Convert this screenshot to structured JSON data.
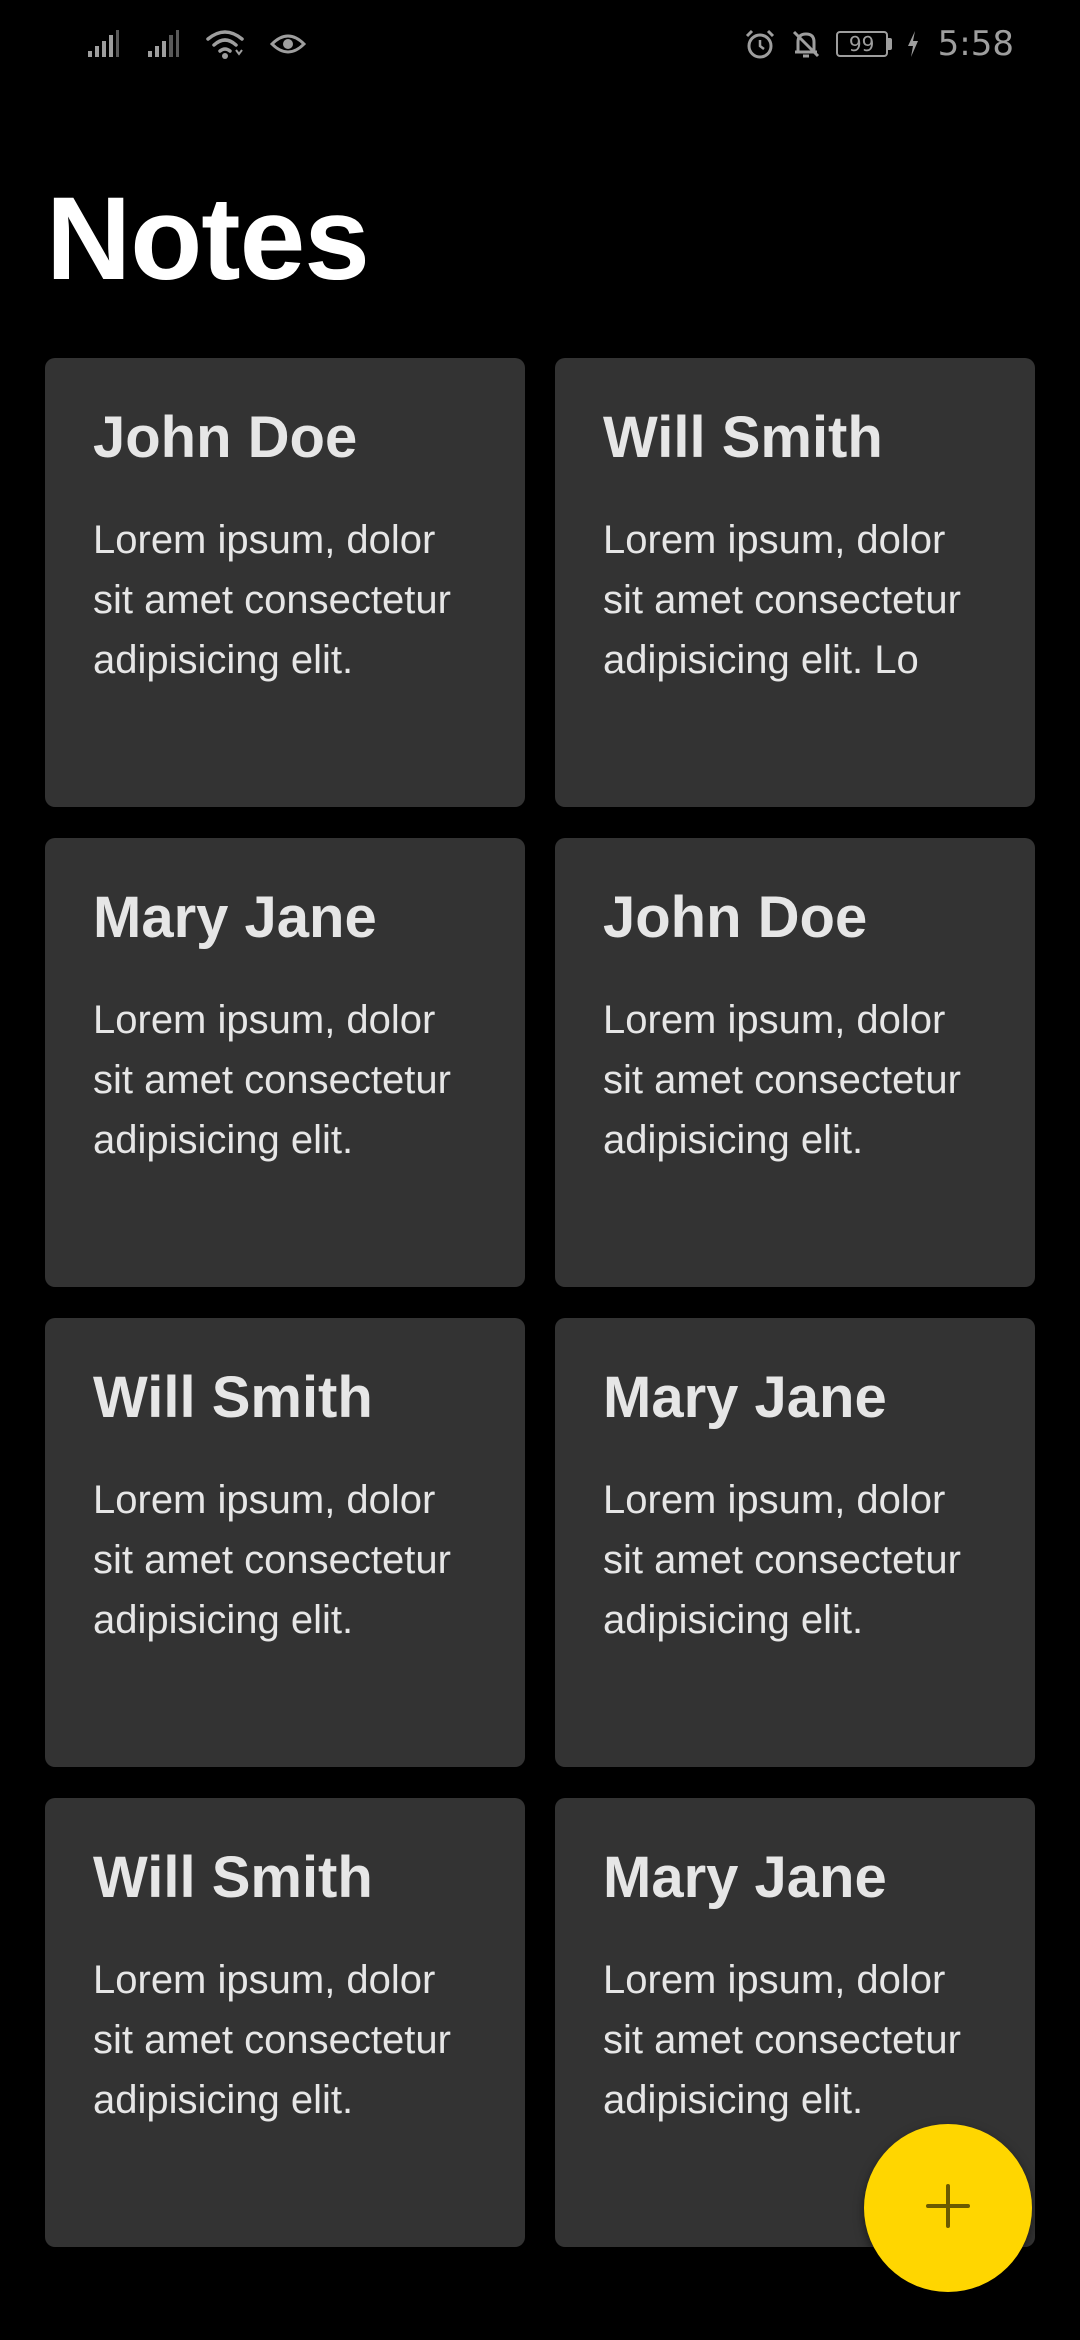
{
  "status_bar": {
    "battery_level": "99",
    "time": "5:58",
    "icons": [
      "signal-icon",
      "signal-icon",
      "wifi-icon",
      "eye-icon",
      "alarm-icon",
      "notifications-off-icon",
      "battery-icon",
      "charging-icon"
    ]
  },
  "header": {
    "title": "Notes"
  },
  "notes": [
    {
      "title": "John Doe",
      "body": "Lorem ipsum, dolor sit amet consectetur adipisicing elit."
    },
    {
      "title": "Will Smith",
      "body": "Lorem ipsum, dolor sit amet consectetur adipisicing elit. Lo"
    },
    {
      "title": "Mary Jane",
      "body": "Lorem ipsum, dolor sit amet consectetur adipisicing elit."
    },
    {
      "title": "John Doe",
      "body": "Lorem ipsum, dolor sit amet consectetur adipisicing elit."
    },
    {
      "title": "Will Smith",
      "body": "Lorem ipsum, dolor sit amet consectetur adipisicing elit."
    },
    {
      "title": "Mary Jane",
      "body": "Lorem ipsum, dolor sit amet consectetur adipisicing elit."
    },
    {
      "title": "Will Smith",
      "body": "Lorem ipsum, dolor sit amet consectetur adipisicing elit."
    },
    {
      "title": "Mary Jane",
      "body": "Lorem ipsum, dolor sit amet consectetur adipisicing elit."
    }
  ],
  "fab": {
    "icon": "plus-icon",
    "color": "#ffd600"
  },
  "colors": {
    "background": "#000000",
    "card": "#333333",
    "accent": "#ffd600"
  }
}
